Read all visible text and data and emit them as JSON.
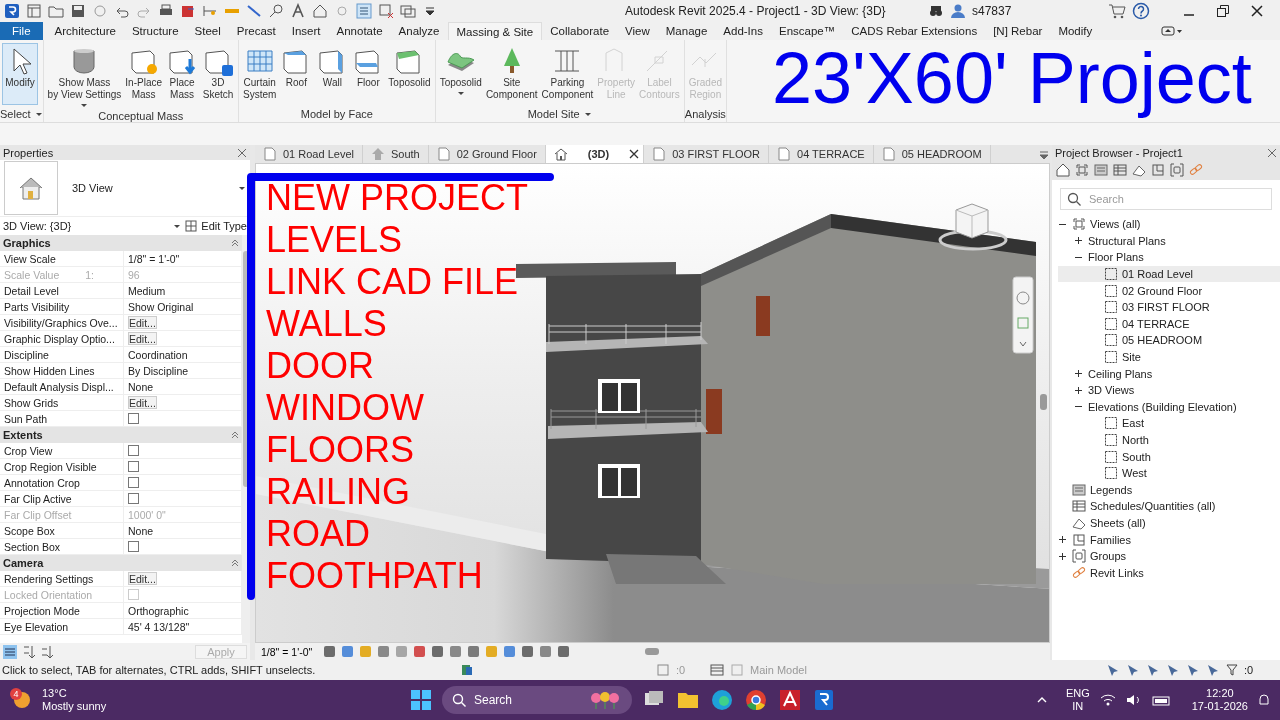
{
  "title_bar": {
    "title": "Autodesk Revit 2025.4 - Project1 - 3D View: {3D}",
    "user": "s47837"
  },
  "ribbon_tabs": [
    {
      "label": "File",
      "kind": "file",
      "selected": false
    },
    {
      "label": "Architecture",
      "kind": "tab",
      "selected": false
    },
    {
      "label": "Structure",
      "kind": "tab",
      "selected": false
    },
    {
      "label": "Steel",
      "kind": "tab",
      "selected": false
    },
    {
      "label": "Precast",
      "kind": "tab",
      "selected": false
    },
    {
      "label": "Insert",
      "kind": "tab",
      "selected": false
    },
    {
      "label": "Annotate",
      "kind": "tab",
      "selected": false
    },
    {
      "label": "Analyze",
      "kind": "tab",
      "selected": false
    },
    {
      "label": "Massing & Site",
      "kind": "tab",
      "selected": true
    },
    {
      "label": "Collaborate",
      "kind": "tab",
      "selected": false
    },
    {
      "label": "View",
      "kind": "tab",
      "selected": false
    },
    {
      "label": "Manage",
      "kind": "tab",
      "selected": false
    },
    {
      "label": "Add-Ins",
      "kind": "tab",
      "selected": false
    },
    {
      "label": "Enscape™",
      "kind": "tab",
      "selected": false
    },
    {
      "label": "CADS Rebar Extensions",
      "kind": "tab",
      "selected": false
    },
    {
      "label": "[N] Rebar",
      "kind": "tab",
      "selected": false
    },
    {
      "label": "Modify",
      "kind": "tab",
      "selected": false
    }
  ],
  "ribbon_panels": [
    {
      "title": "Select",
      "menu": true,
      "tools": [
        {
          "label": "Modify",
          "menu": false,
          "disabled": false,
          "selected": true
        }
      ]
    },
    {
      "title": "Conceptual Mass",
      "menu": false,
      "tools": [
        {
          "label": "Show Mass\nby View Settings",
          "menu": true,
          "disabled": false,
          "selected": false
        },
        {
          "label": "In-Place\nMass",
          "menu": false,
          "disabled": false,
          "selected": false
        },
        {
          "label": "Place\nMass",
          "menu": false,
          "disabled": false,
          "selected": false
        },
        {
          "label": "3D\nSketch",
          "menu": false,
          "disabled": false,
          "selected": false
        }
      ]
    },
    {
      "title": "Model by Face",
      "menu": false,
      "tools": [
        {
          "label": "Curtain\nSystem",
          "menu": false,
          "disabled": false,
          "selected": false
        },
        {
          "label": "Roof",
          "menu": false,
          "disabled": false,
          "selected": false
        },
        {
          "label": "Wall",
          "menu": false,
          "disabled": false,
          "selected": false
        },
        {
          "label": "Floor",
          "menu": false,
          "disabled": false,
          "selected": false
        },
        {
          "label": "Toposolid",
          "menu": false,
          "disabled": false,
          "selected": false
        }
      ]
    },
    {
      "title": "Model Site",
      "menu": true,
      "tools": [
        {
          "label": "Toposolid",
          "menu": true,
          "disabled": false,
          "selected": false
        },
        {
          "label": "Site\nComponent",
          "menu": false,
          "disabled": false,
          "selected": false
        },
        {
          "label": "Parking\nComponent",
          "menu": false,
          "disabled": false,
          "selected": false
        },
        {
          "label": "Property\nLine",
          "menu": false,
          "disabled": true,
          "selected": false
        },
        {
          "label": "Label\nContours",
          "menu": false,
          "disabled": true,
          "selected": false
        }
      ]
    },
    {
      "title": "Analysis",
      "menu": false,
      "tools": [
        {
          "label": "Graded\nRegion",
          "menu": false,
          "disabled": true,
          "selected": false
        }
      ]
    }
  ],
  "annotations": {
    "title": "23'X60' Project",
    "notes": [
      "NEW PROJECT",
      "LEVELS",
      "LINK CAD FILE",
      "WALLS",
      "DOOR",
      "WINDOW",
      "FLOORS",
      "RAILING",
      "ROAD",
      "FOOTHPATH"
    ]
  },
  "properties": {
    "title": "Properties",
    "type_name": "3D View",
    "instance": "3D View: {3D}",
    "edit_type": "Edit Type",
    "apply": "Apply",
    "groups": [
      {
        "name": "Graphics",
        "rows": [
          {
            "label": "View Scale",
            "kind": "text",
            "value": "1/8\" = 1'-0\"",
            "disabled": false
          },
          {
            "label": "Scale Value",
            "unit": "1:",
            "kind": "text",
            "value": "96",
            "disabled": true
          },
          {
            "label": "Detail Level",
            "kind": "text",
            "value": "Medium",
            "disabled": false
          },
          {
            "label": "Parts Visibility",
            "kind": "text",
            "value": "Show Original",
            "disabled": false
          },
          {
            "label": "Visibility/Graphics Ove...",
            "kind": "button",
            "value": "Edit...",
            "disabled": false
          },
          {
            "label": "Graphic Display Optio...",
            "kind": "button",
            "value": "Edit...",
            "disabled": false
          },
          {
            "label": "Discipline",
            "kind": "text",
            "value": "Coordination",
            "disabled": false
          },
          {
            "label": "Show Hidden Lines",
            "kind": "text",
            "value": "By Discipline",
            "disabled": false
          },
          {
            "label": "Default Analysis Displ...",
            "kind": "text",
            "value": "None",
            "disabled": false
          },
          {
            "label": "Show Grids",
            "kind": "button",
            "value": "Edit...",
            "disabled": false
          },
          {
            "label": "Sun Path",
            "kind": "checkbox",
            "checked": false,
            "disabled": false
          }
        ]
      },
      {
        "name": "Extents",
        "rows": [
          {
            "label": "Crop View",
            "kind": "checkbox",
            "checked": false,
            "disabled": false
          },
          {
            "label": "Crop Region Visible",
            "kind": "checkbox",
            "checked": false,
            "disabled": false
          },
          {
            "label": "Annotation Crop",
            "kind": "checkbox",
            "checked": false,
            "disabled": false
          },
          {
            "label": "Far Clip Active",
            "kind": "checkbox",
            "checked": false,
            "disabled": false
          },
          {
            "label": "Far Clip Offset",
            "kind": "text",
            "value": "1000'  0\"",
            "disabled": true
          },
          {
            "label": "Scope Box",
            "kind": "text",
            "value": "None",
            "disabled": false
          },
          {
            "label": "Section Box",
            "kind": "checkbox",
            "checked": false,
            "disabled": false
          }
        ]
      },
      {
        "name": "Camera",
        "rows": [
          {
            "label": "Rendering Settings",
            "kind": "button",
            "value": "Edit...",
            "disabled": false
          },
          {
            "label": "Locked Orientation",
            "kind": "checkbox",
            "checked": false,
            "disabled": true
          },
          {
            "label": "Projection Mode",
            "kind": "text",
            "value": "Orthographic",
            "disabled": false
          },
          {
            "label": "Eye Elevation",
            "kind": "text",
            "value": "45'  4 13/128\"",
            "disabled": false
          }
        ]
      }
    ]
  },
  "view_tabs": [
    {
      "label": "01 Road Level",
      "kind": "plan",
      "selected": false
    },
    {
      "label": "South",
      "kind": "elevation",
      "selected": false
    },
    {
      "label": "02 Ground Floor",
      "kind": "plan",
      "selected": false
    },
    {
      "label": "(3D)",
      "kind": "model",
      "selected": true
    },
    {
      "label": "03 FIRST FLOOR",
      "kind": "plan",
      "selected": false
    },
    {
      "label": "04 TERRACE",
      "kind": "plan",
      "selected": false
    },
    {
      "label": "05 HEADROOM",
      "kind": "plan",
      "selected": false
    }
  ],
  "view": {
    "scale": "1/8\" = 1'-0\""
  },
  "project_browser": {
    "title": "Project Browser - Project1",
    "search_placeholder": "Search",
    "tree": [
      {
        "label": "Views (all)",
        "kind": "views",
        "expanded": true,
        "selected": false,
        "children": [
          {
            "label": "Structural Plans",
            "expanded": false,
            "selected": false
          },
          {
            "label": "Floor Plans",
            "expanded": true,
            "selected": false,
            "children": [
              {
                "label": "01 Road Level",
                "kind": "view",
                "selected": true
              },
              {
                "label": "02 Ground Floor",
                "kind": "view",
                "selected": false
              },
              {
                "label": "03 FIRST FLOOR",
                "kind": "view",
                "selected": false
              },
              {
                "label": "04 TERRACE",
                "kind": "view",
                "selected": false
              },
              {
                "label": "05 HEADROOM",
                "kind": "view",
                "selected": false
              },
              {
                "label": "Site",
                "kind": "view",
                "selected": false
              }
            ]
          },
          {
            "label": "Ceiling Plans",
            "expanded": false,
            "selected": false
          },
          {
            "label": "3D Views",
            "expanded": false,
            "selected": false
          },
          {
            "label": "Elevations (Building Elevation)",
            "expanded": true,
            "selected": false,
            "children": [
              {
                "label": "East",
                "kind": "view",
                "selected": false
              },
              {
                "label": "North",
                "kind": "view",
                "selected": false
              },
              {
                "label": "South",
                "kind": "view",
                "selected": false
              },
              {
                "label": "West",
                "kind": "view",
                "selected": false
              }
            ]
          }
        ]
      },
      {
        "label": "Legends",
        "kind": "legends",
        "selected": false
      },
      {
        "label": "Schedules/Quantities (all)",
        "kind": "schedules",
        "selected": false
      },
      {
        "label": "Sheets (all)",
        "kind": "sheets",
        "selected": false
      },
      {
        "label": "Families",
        "kind": "families",
        "expanded": false,
        "selected": false
      },
      {
        "label": "Groups",
        "kind": "groups",
        "expanded": false,
        "selected": false
      },
      {
        "label": "Revit Links",
        "kind": "links",
        "selected": false
      }
    ]
  },
  "status_bar": {
    "message": "Click to select, TAB for alternates, CTRL adds, SHIFT unselects.",
    "workset_count": ":0",
    "model": "Main Model",
    "filter_count": ":0"
  },
  "taskbar": {
    "weather_badge": "4",
    "temperature": "13°C",
    "weather": "Mostly sunny",
    "search": "Search",
    "language": "ENG",
    "region": "IN",
    "time": "12:20",
    "date": "17-01-2026"
  }
}
